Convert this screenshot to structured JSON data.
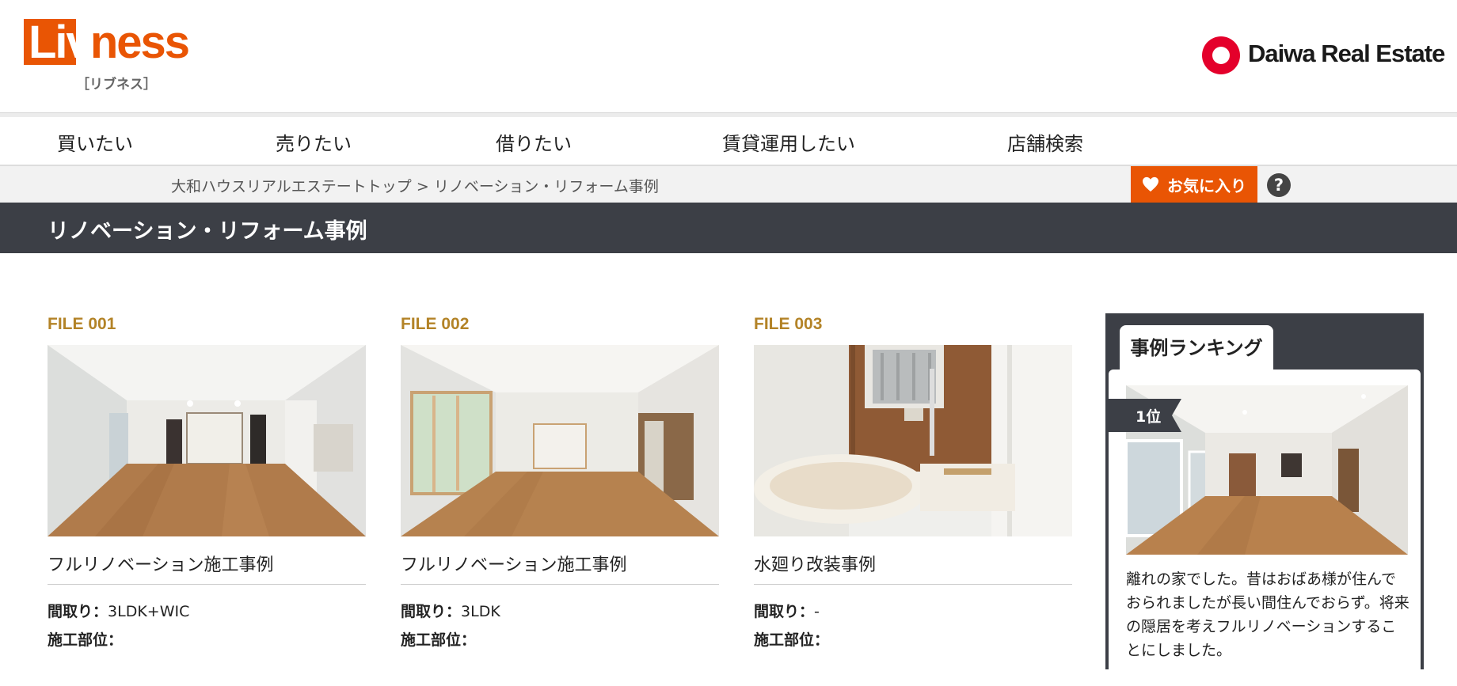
{
  "header": {
    "logo_text_1": "Li",
    "logo_text_2": "v",
    "logo_text_3": "ness",
    "logo_sub": "［リブネス］",
    "brand_right": "Daiwa Real Estate"
  },
  "nav": {
    "items": [
      "買いたい",
      "売りたい",
      "借りたい",
      "賃貸運用したい",
      "店舗検索"
    ]
  },
  "breadcrumb": {
    "home": "大和ハウスリアルエステートトップ",
    "separator": " > ",
    "current": "リノベーション・リフォーム事例"
  },
  "actions": {
    "favorite_label": "お気に入り",
    "help_label": "?"
  },
  "page": {
    "title": "リノベーション・リフォーム事例"
  },
  "cards": [
    {
      "file": "FILE 001",
      "title": "フルリノベーション施工事例",
      "layout_label": "間取り：",
      "layout_value": "3LDK+WIC",
      "area_label": "施工部位："
    },
    {
      "file": "FILE 002",
      "title": "フルリノベーション施工事例",
      "layout_label": "間取り：",
      "layout_value": "3LDK",
      "area_label": "施工部位："
    },
    {
      "file": "FILE 003",
      "title": "水廻り改装事例",
      "layout_label": "間取り：",
      "layout_value": "-",
      "area_label": "施工部位："
    }
  ],
  "ranking": {
    "tab_label": "事例ランキング",
    "rank_label": "1位",
    "description": "離れの家でした。昔はおばあ様が住んでおられましたが長い間住んでおらず。将来の隠居を考えフルリノベーションすることにしました。"
  },
  "colors": {
    "brand_orange": "#e95504",
    "dark_band": "#3c3f46",
    "file_gold": "#b38327",
    "daiwa_red": "#e4002b"
  }
}
